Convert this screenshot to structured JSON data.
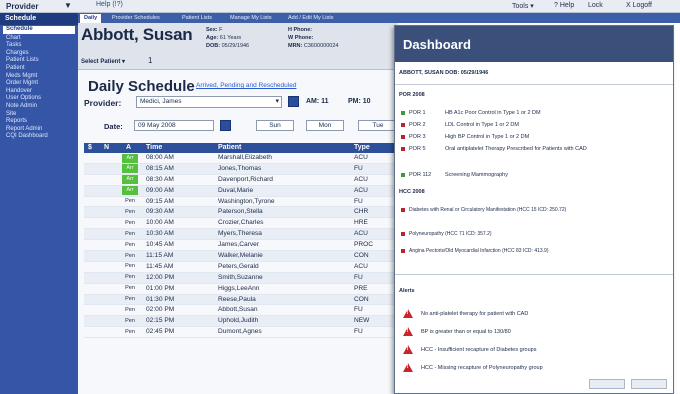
{
  "topbar": {
    "provider_label": "Provider",
    "home_label": "Help (!?)",
    "tools_label": "Tools ▾",
    "help_label": "? Help",
    "lock_label": "Lock",
    "logoff_label": "X Logoff"
  },
  "sidebar": {
    "header": "Schedule",
    "items": [
      "Schedule",
      "Chart",
      "Tasks",
      "Charges",
      "Patient Lists",
      "Patient",
      "Meds Mgmt",
      "Order Mgmt",
      "Handover",
      "User Options",
      "Note Admin",
      "Site",
      "Reports",
      "Report Admin",
      "CQI Dashboard"
    ]
  },
  "tabs": [
    "Daily",
    "Provider Schedules",
    "Patient Lists",
    "Manage My Lists",
    "Add / Edit My Lists"
  ],
  "patient": {
    "name": "Abbott, Susan",
    "select_label": "Select Patient ▾",
    "select_count": "1",
    "sex_label": "Sex:",
    "sex": "F",
    "age_label": "Age:",
    "age": "61 Years",
    "dob_label": "DOB:",
    "dob": "05/29/1946",
    "hphone_label": "H Phone:",
    "hphone": "",
    "wphone_label": "W Phone:",
    "wphone": "",
    "mrn_label": "MRN:",
    "mrn": "C3600000024"
  },
  "schedule": {
    "title": "Daily Schedule",
    "arrived_link": "Arrived, Pending and Rescheduled",
    "provider_label": "Provider:",
    "provider_value": "Medici, James",
    "am_label": "AM: 11",
    "pm_label": "PM: 10",
    "date_label": "Date:",
    "date_value": "09 May 2008",
    "day_buttons": [
      "Sun",
      "Mon",
      "Tue"
    ],
    "columns": [
      "$",
      "N",
      "A",
      "Time",
      "Patient",
      "Type"
    ],
    "rows": [
      {
        "status": "Arr",
        "time": "08:00 AM",
        "patient": "Marshall,Elizabeth",
        "type": "ACU"
      },
      {
        "status": "Arr",
        "time": "08:15 AM",
        "patient": "Jones,Thomas",
        "type": "FU"
      },
      {
        "status": "Arr",
        "time": "08:30 AM",
        "patient": "Davenport,Richard",
        "type": "ACU"
      },
      {
        "status": "Arr",
        "time": "09:00 AM",
        "patient": "Duval,Marie",
        "type": "ACU"
      },
      {
        "status": "Pen",
        "time": "09:15 AM",
        "patient": "Washington,Tyrone",
        "type": "FU"
      },
      {
        "status": "Pen",
        "time": "09:30 AM",
        "patient": "Paterson,Stella",
        "type": "CHR"
      },
      {
        "status": "Pen",
        "time": "10:00 AM",
        "patient": "Crozier,Charles",
        "type": "HRE"
      },
      {
        "status": "Pen",
        "time": "10:30 AM",
        "patient": "Myers,Theresa",
        "type": "ACU"
      },
      {
        "status": "Pen",
        "time": "10:45 AM",
        "patient": "James,Carver",
        "type": "PROC"
      },
      {
        "status": "Pen",
        "time": "11:15 AM",
        "patient": "Walker,Melanie",
        "type": "CON"
      },
      {
        "status": "Pen",
        "time": "11:45 AM",
        "patient": "Peters,Gerald",
        "type": "ACU"
      },
      {
        "status": "Pen",
        "time": "12:00 PM",
        "patient": "Smith,Suzanne",
        "type": "FU"
      },
      {
        "status": "Pen",
        "time": "01:00 PM",
        "patient": "Higgs,LeeAnn",
        "type": "PRE"
      },
      {
        "status": "Pen",
        "time": "01:30 PM",
        "patient": "Reese,Paula",
        "type": "CON"
      },
      {
        "status": "Pen",
        "time": "02:00 PM",
        "patient": "Abbott,Susan",
        "type": "FU"
      },
      {
        "status": "Pen",
        "time": "02:15 PM",
        "patient": "Uphold,Judith",
        "type": "NEW"
      },
      {
        "status": "Pen",
        "time": "02:45 PM",
        "patient": "Dumont,Agnes",
        "type": "FU"
      }
    ]
  },
  "dashboard": {
    "title": "Dashboard",
    "patient_info": "ABBOTT, SUSAN    DOB: 05/29/1946",
    "por_title": "POR 2008",
    "por_items": [
      {
        "code": "POR 1",
        "desc": "HB A1c Poor Control in Type 1 or 2 DM",
        "color": "#3f9a3a"
      },
      {
        "code": "POR 2",
        "desc": "LDL Control in Type 1 or 2 DM",
        "color": "#b3262d"
      },
      {
        "code": "POR 3",
        "desc": "High BP Control in Type 1 or 2 DM",
        "color": "#b3262d"
      },
      {
        "code": "POR 5",
        "desc": "Oral antiplatelet Therapy Prescribed for Patients with CAD",
        "color": "#b3262d"
      },
      {
        "code": "POR 112",
        "desc": "Screening Mammography",
        "color": "#3f9a3a"
      }
    ],
    "hcc_title": "HCC 2008",
    "hcc_items": [
      "Diabetes with Renal or Circulatory Manifestation (HCC 15 ICD: 250.72)",
      "Polyneuropathy (HCC 71 ICD: 357.2)",
      "Angina Pectoris/Old Myocardial Infarction (HCC 83 ICD: 413.9)"
    ],
    "alerts_title": "Alerts",
    "alerts": [
      "No anti-platelet therapy for patient with CAD",
      "BP is greater than or equal to 130/80",
      "HCC - Insufficient recapture of Diabetes groups",
      "HCC - Missing recapture of Polyneuropathy group"
    ]
  }
}
